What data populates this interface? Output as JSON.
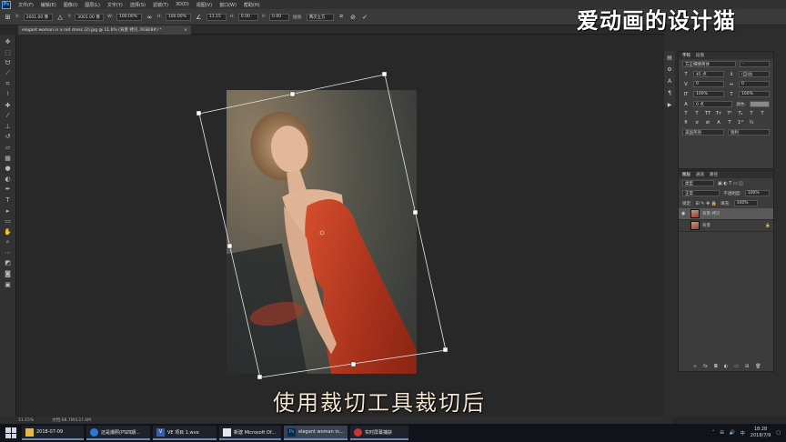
{
  "menubar": {
    "logo": "Ps",
    "items": [
      "文件(F)",
      "编辑(E)",
      "图像(I)",
      "图层(L)",
      "文字(Y)",
      "选择(S)",
      "滤镜(T)",
      "3D(D)",
      "视图(V)",
      "窗口(W)",
      "帮助(H)"
    ]
  },
  "options": {
    "x_label": "X:",
    "x_value": "2001.00 像",
    "y_label": "Y:",
    "y_value": "3001.00 像",
    "w_label": "W:",
    "w_value": "100.00%",
    "h_label": "H:",
    "h_value": "100.00%",
    "angle_value": "11.15",
    "h_skew_label": "H:",
    "h_skew_value": "0.00",
    "v_skew_label": "V:",
    "v_skew_value": "0.00",
    "interp_label": "插值:",
    "interp_value": "两次立方"
  },
  "document": {
    "tab_title": "elegant woman in a red dress (2).jpg @ 11.6% (背景 拷贝, RGB/8#) *"
  },
  "tools": [
    "move-icon",
    "marquee-icon",
    "lasso-icon",
    "quick-select-icon",
    "crop-icon",
    "eyedropper-icon",
    "healing-icon",
    "brush-icon",
    "stamp-icon",
    "history-brush-icon",
    "eraser-icon",
    "gradient-icon",
    "blur-icon",
    "dodge-icon",
    "pen-icon",
    "type-icon",
    "path-select-icon",
    "shape-icon",
    "hand-icon",
    "zoom-icon"
  ],
  "character_panel": {
    "tabs": [
      "字符",
      "段落"
    ],
    "font_family": "方正细倩简体",
    "font_size": "45 点",
    "leading": "(自动)",
    "tracking": "0",
    "kerning": "0",
    "vertical_scale": "100%",
    "horizontal_scale": "100%",
    "baseline_shift": "0 点",
    "color_label": "颜色:",
    "style_buttons": [
      "T",
      "T",
      "TT",
      "Tт",
      "T¹",
      "T₁",
      "T",
      "T"
    ],
    "language": "美国英语",
    "aa": "锐利"
  },
  "layers_panel": {
    "tabs": [
      "图层",
      "通道",
      "路径"
    ],
    "kind_label": "类型",
    "blend_mode": "正常",
    "opacity_label": "不透明度:",
    "opacity_value": "100%",
    "lock_label": "锁定:",
    "fill_label": "填充:",
    "fill_value": "100%",
    "layers": [
      {
        "name": "背景 拷贝",
        "selected": true,
        "visible": true
      },
      {
        "name": "背景",
        "selected": false,
        "visible": false,
        "locked": true
      }
    ]
  },
  "status": {
    "zoom": "11.15%",
    "doc_info": "文档:68.7M/137.4M"
  },
  "watermark": "爱动画的设计猫",
  "subtitle": "使用裁切工具裁切后",
  "taskbar": {
    "items": [
      {
        "label": "2018-07-09",
        "icon": "folder-icon"
      },
      {
        "label": "还是爆照(PS四期...",
        "icon": "browser-icon"
      },
      {
        "label": "VE 项目 1.wve",
        "icon": "video-editor-icon"
      },
      {
        "label": "新建 Microsoft Of...",
        "icon": "document-icon"
      },
      {
        "label": "elegant woman in...",
        "icon": "photoshop-icon"
      },
      {
        "label": "实时屏幕捕获",
        "icon": "record-icon"
      }
    ],
    "active_index": 4,
    "time": "18:28",
    "date": "2018/7/9"
  },
  "colors": {
    "accent": "#4da6ff",
    "dress_red": "#b83a22"
  }
}
